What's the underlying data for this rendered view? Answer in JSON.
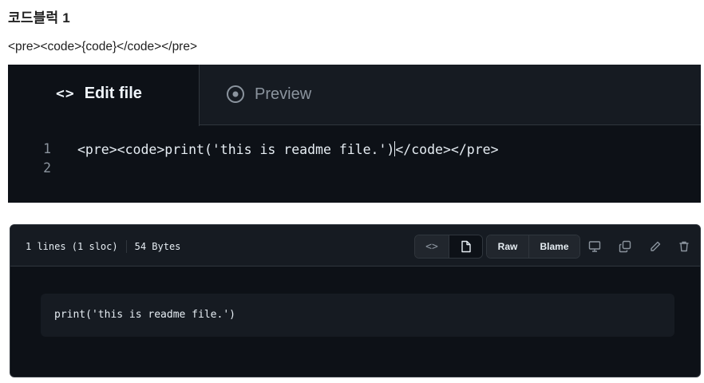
{
  "heading": "코드블럭 1",
  "subline": "<pre><code>{code}</code></pre>",
  "editor": {
    "tabs": [
      {
        "icon": "code-brackets-icon",
        "label": "Edit file",
        "active": true
      },
      {
        "icon": "eye-icon",
        "label": "Preview",
        "active": false
      }
    ],
    "code_glyph": "<>",
    "lines": [
      {
        "number": "1",
        "before_cursor": "<pre><code>print('this is readme file.')",
        "after_cursor": "</code></pre>"
      },
      {
        "number": "2",
        "before_cursor": "",
        "after_cursor": ""
      }
    ]
  },
  "file_view": {
    "lines_info": "1 lines (1 sloc)",
    "size": "54 Bytes",
    "view_toggle": {
      "code_glyph": "<>",
      "icons": [
        "code-icon",
        "file-icon"
      ],
      "active": "code"
    },
    "raw_label": "Raw",
    "blame_label": "Blame",
    "action_icons": [
      "desktop-icon",
      "copy-icon",
      "pencil-icon",
      "trash-icon"
    ],
    "code": "print('this is readme file.')"
  },
  "colors": {
    "editor_bg": "#0d1117",
    "tab_bar_bg": "#161b22",
    "border": "#30363d",
    "text": "#e6edf3",
    "muted": "#8b949e"
  }
}
